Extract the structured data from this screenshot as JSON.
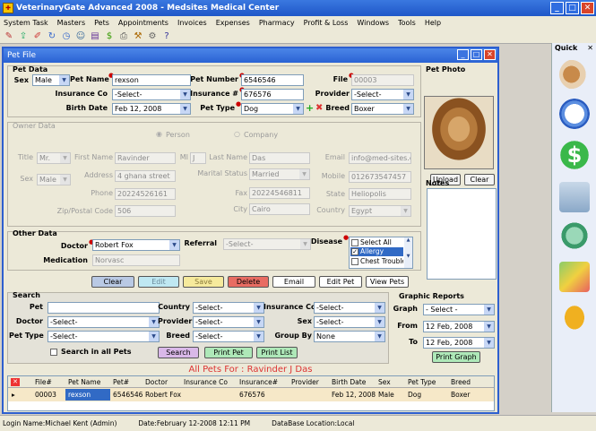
{
  "app": {
    "title": "VeterinaryGate Advanced 2008 - Medsites Medical Center",
    "min": "_",
    "max": "□",
    "close": "✕"
  },
  "menu": [
    "System Task",
    "Masters",
    "Pets",
    "Appointments",
    "Invoices",
    "Expenses",
    "Pharmacy",
    "Profit & Loss",
    "Windows",
    "Tools",
    "Help"
  ],
  "toolbar_icons": [
    "new-icon",
    "open-icon",
    "edit-icon",
    "refresh-icon",
    "clock-icon",
    "users-icon",
    "report-icon",
    "money-icon",
    "print-icon",
    "tools-icon",
    "settings-icon",
    "help-icon"
  ],
  "pet_window": {
    "title": "Pet File",
    "min": "_",
    "max": "□",
    "close": "✕"
  },
  "pet_data": {
    "section": "Pet Data",
    "sex_label": "Sex",
    "sex_value": "Male",
    "name_label": "Pet Name",
    "name_value": "rexson",
    "number_label": "Pet Number",
    "number_value": "6546546",
    "file_label": "File",
    "file_value": "00003",
    "insco_label": "Insurance Co",
    "insco_value": "-Select-",
    "insno_label": "Insurance #",
    "insno_value": "676576",
    "provider_label": "Provider",
    "provider_value": "-Select-",
    "birth_label": "Birth Date",
    "birth_value": "Feb 12, 2008",
    "type_label": "Pet Type",
    "type_value": "Dog",
    "breed_label": "Breed",
    "breed_value": "Boxer",
    "add_symbol": "+",
    "remove_symbol": "✖"
  },
  "photo": {
    "label": "Pet Photo",
    "upload": "Upload",
    "clear": "Clear"
  },
  "notes": {
    "label": "Notes"
  },
  "owner": {
    "section": "Owner Data",
    "person": "Person",
    "company": "Company",
    "title_label": "Title",
    "title_value": "Mr.",
    "first_label": "First Name",
    "first_value": "Ravinder",
    "mi_label": "MI",
    "mi_value": "J",
    "last_label": "Last Name",
    "last_value": "Das",
    "email_label": "Email",
    "email_value": "info@med-sites.c",
    "sex_label": "Sex",
    "sex_value": "Male",
    "address_label": "Address",
    "address_value": "4 ghana street",
    "marital_label": "Marital Status",
    "marital_value": "Married",
    "mobile_label": "Mobile",
    "mobile_value": "012673547457",
    "phone_label": "Phone",
    "phone_value": "20224526161",
    "fax_label": "Fax",
    "fax_value": "20224546811",
    "state_label": "State",
    "state_value": "Heliopolis",
    "zip_label": "Zip/Postal Code",
    "zip_value": "506",
    "city_label": "City",
    "city_value": "Cairo",
    "country_label": "Country",
    "country_value": "Egypt"
  },
  "other": {
    "section": "Other Data",
    "doctor_label": "Doctor",
    "doctor_value": "Robert Fox",
    "referral_label": "Referral",
    "referral_value": "-Select-",
    "disease_label": "Disease",
    "disease_items": [
      {
        "label": "Select All",
        "checked": false
      },
      {
        "label": "Allergy",
        "checked": true
      },
      {
        "label": "Chest Trouble",
        "checked": false
      }
    ],
    "medication_label": "Medication",
    "medication_value": "Norvasc"
  },
  "actions": {
    "clear": "Clear",
    "edit": "Edit",
    "save": "Save",
    "delete": "Delete",
    "email": "Email",
    "edit_pet": "Edit Pet",
    "view_pets": "View Pets"
  },
  "search": {
    "section": "Search",
    "pet_label": "Pet",
    "pet_value": "",
    "country_label": "Country",
    "country_value": "-Select-",
    "insco_label": "Insurance Co",
    "insco_value": "-Select-",
    "doctor_label": "Doctor",
    "doctor_value": "-Select-",
    "provider_label": "Provider",
    "provider_value": "-Select-",
    "sex_label": "Sex",
    "sex_value": "-Select-",
    "type_label": "Pet Type",
    "type_value": "-Select-",
    "breed_label": "Breed",
    "breed_value": "-Select-",
    "group_label": "Group By",
    "group_value": "None",
    "all_label": "Search in all Pets",
    "search_btn": "Search",
    "print_pet": "Print Pet",
    "print_list": "Print List"
  },
  "graphic": {
    "section": "Graphic Reports",
    "graph_label": "Graph",
    "graph_value": "- Select -",
    "from_label": "From",
    "from_value": "12 Feb, 2008",
    "to_label": "To",
    "to_value": "12 Feb, 2008",
    "print": "Print Graph"
  },
  "list": {
    "title": "All Pets For : Ravinder J Das",
    "columns": [
      "File#",
      "Pet Name",
      "Pet#",
      "Doctor",
      "Insurance Co",
      "Insurance#",
      "Provider",
      "Birth Date",
      "Sex",
      "Pet Type",
      "Breed"
    ],
    "rows": [
      [
        "00003",
        "rexson",
        "6546546",
        "Robert Fox",
        "",
        "676576",
        "",
        "Feb 12, 2008",
        "Male",
        "Dog",
        "Boxer"
      ]
    ]
  },
  "quick": {
    "title": "Quick"
  },
  "status": {
    "login": "Login Name:Michael Kent (Admin)",
    "date": "Date:February 12-2008   12:11  PM",
    "db": "DataBase Location:Local"
  }
}
